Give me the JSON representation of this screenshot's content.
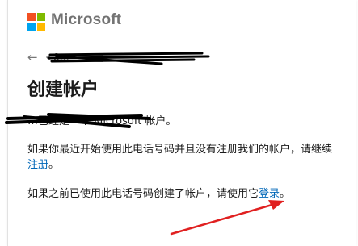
{
  "brand": {
    "name": "Microsoft",
    "logo_colors": [
      "#f25022",
      "#7fba00",
      "#00a4ef",
      "#ffb900"
    ]
  },
  "back": {
    "icon": "arrow-left-icon",
    "identity": "+8…"
  },
  "title": "创建帐户",
  "message_line": "…已经是一个 Microsoft 帐户。",
  "paragraph_new": {
    "text": "如果你最近开始使用此电话号码并且没有注册我们的帐户，请继续 ",
    "link": "注册",
    "end": "。"
  },
  "paragraph_existing": {
    "text": "如果之前已使用此电话号码创建了帐户，请使用它",
    "link": "登录",
    "end": "。"
  },
  "colors": {
    "link": "#0067b8",
    "annotation_arrow": "#e02020",
    "redaction": "#000000"
  }
}
